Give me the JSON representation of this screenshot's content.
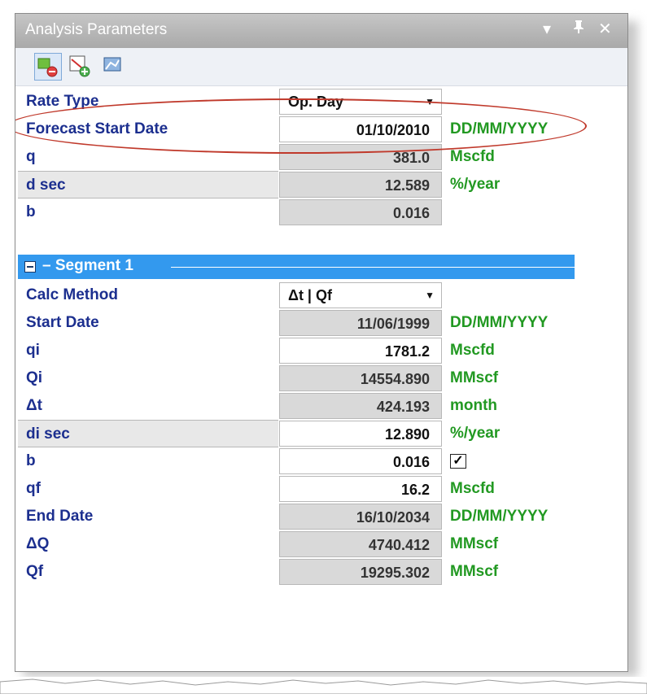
{
  "window": {
    "title": "Analysis Parameters",
    "controls": [
      "▾",
      "ᵰ",
      "✕"
    ]
  },
  "toolbar": {
    "buttons": [
      "add-remove-segment-icon",
      "add-segment-icon",
      "chart-icon"
    ]
  },
  "params": {
    "rate_type": {
      "label": "Rate Type",
      "value": "Op. Day"
    },
    "forecast_start": {
      "label": "Forecast Start Date",
      "value": "01/10/2010",
      "unit": "DD/MM/YYYY"
    },
    "q": {
      "label": "q",
      "value": "381.0",
      "unit": "Mscfd"
    },
    "dsec": {
      "label": "d sec",
      "value": "12.589",
      "unit": "%/year"
    },
    "b": {
      "label": "b",
      "value": "0.016"
    }
  },
  "segment": {
    "title": "– Segment 1",
    "calc_method": {
      "label": "Calc Method",
      "value": "Δt | Qf"
    },
    "start_date": {
      "label": "Start Date",
      "value": "11/06/1999",
      "unit": "DD/MM/YYYY"
    },
    "qi": {
      "label": "qi",
      "value": "1781.2",
      "unit": "Mscfd"
    },
    "Qi": {
      "label": "Qi",
      "value": "14554.890",
      "unit": "MMscf"
    },
    "dt": {
      "label": "Δt",
      "value": "424.193",
      "unit": "month"
    },
    "disec": {
      "label": "di sec",
      "value": "12.890",
      "unit": "%/year"
    },
    "b": {
      "label": "b",
      "value": "0.016",
      "checked": true
    },
    "qf": {
      "label": "qf",
      "value": "16.2",
      "unit": "Mscfd"
    },
    "end_date": {
      "label": "End Date",
      "value": "16/10/2034",
      "unit": "DD/MM/YYYY"
    },
    "dQ": {
      "label": "ΔQ",
      "value": "4740.412",
      "unit": "MMscf"
    },
    "Qf": {
      "label": "Qf",
      "value": "19295.302",
      "unit": "MMscf"
    }
  },
  "colors": {
    "label": "#1c2f8f",
    "unit": "#229922",
    "segment_bar": "#3399ee",
    "highlight": "#c0392b"
  }
}
